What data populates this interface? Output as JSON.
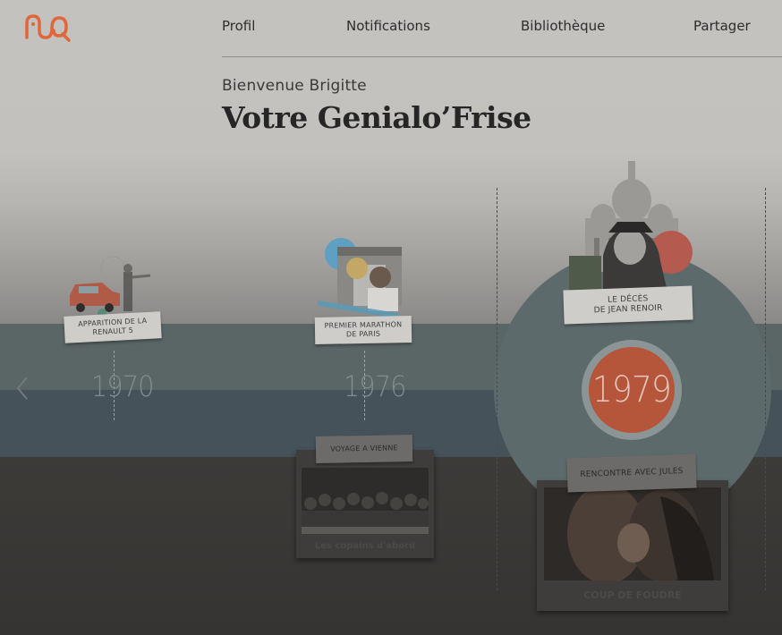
{
  "nav": {
    "profile": "Profil",
    "notifications": "Notifications",
    "library": "Bibliothèque",
    "share": "Partager"
  },
  "header": {
    "welcome": "Bienvenue Brigitte",
    "title": "Votre Genialo’Frise"
  },
  "timeline": {
    "years": [
      "1970",
      "1976",
      "1979"
    ],
    "events_above": [
      {
        "line1": "APPARITION DE LA",
        "line2": "RENAULT 5"
      },
      {
        "line1": "PREMIER MARATHON",
        "line2": "DE PARIS"
      },
      {
        "line1": "LE DÉCÈS",
        "line2": "DE JEAN RENOIR"
      }
    ],
    "events_below": [
      {
        "label": "VOYAGE A VIENNE",
        "caption": "Les copains d'abord"
      },
      {
        "label": "RENCONTRE AVEC JULES",
        "caption": "COUP DE FOUDRE"
      }
    ]
  },
  "colors": {
    "brand": "#e0663c",
    "accent_year": "#b5553a",
    "band_teal": "#5a6565",
    "band_slate": "#46525a"
  },
  "icons": {
    "logo": "genialo-logo",
    "prev": "chevron-left-icon"
  }
}
